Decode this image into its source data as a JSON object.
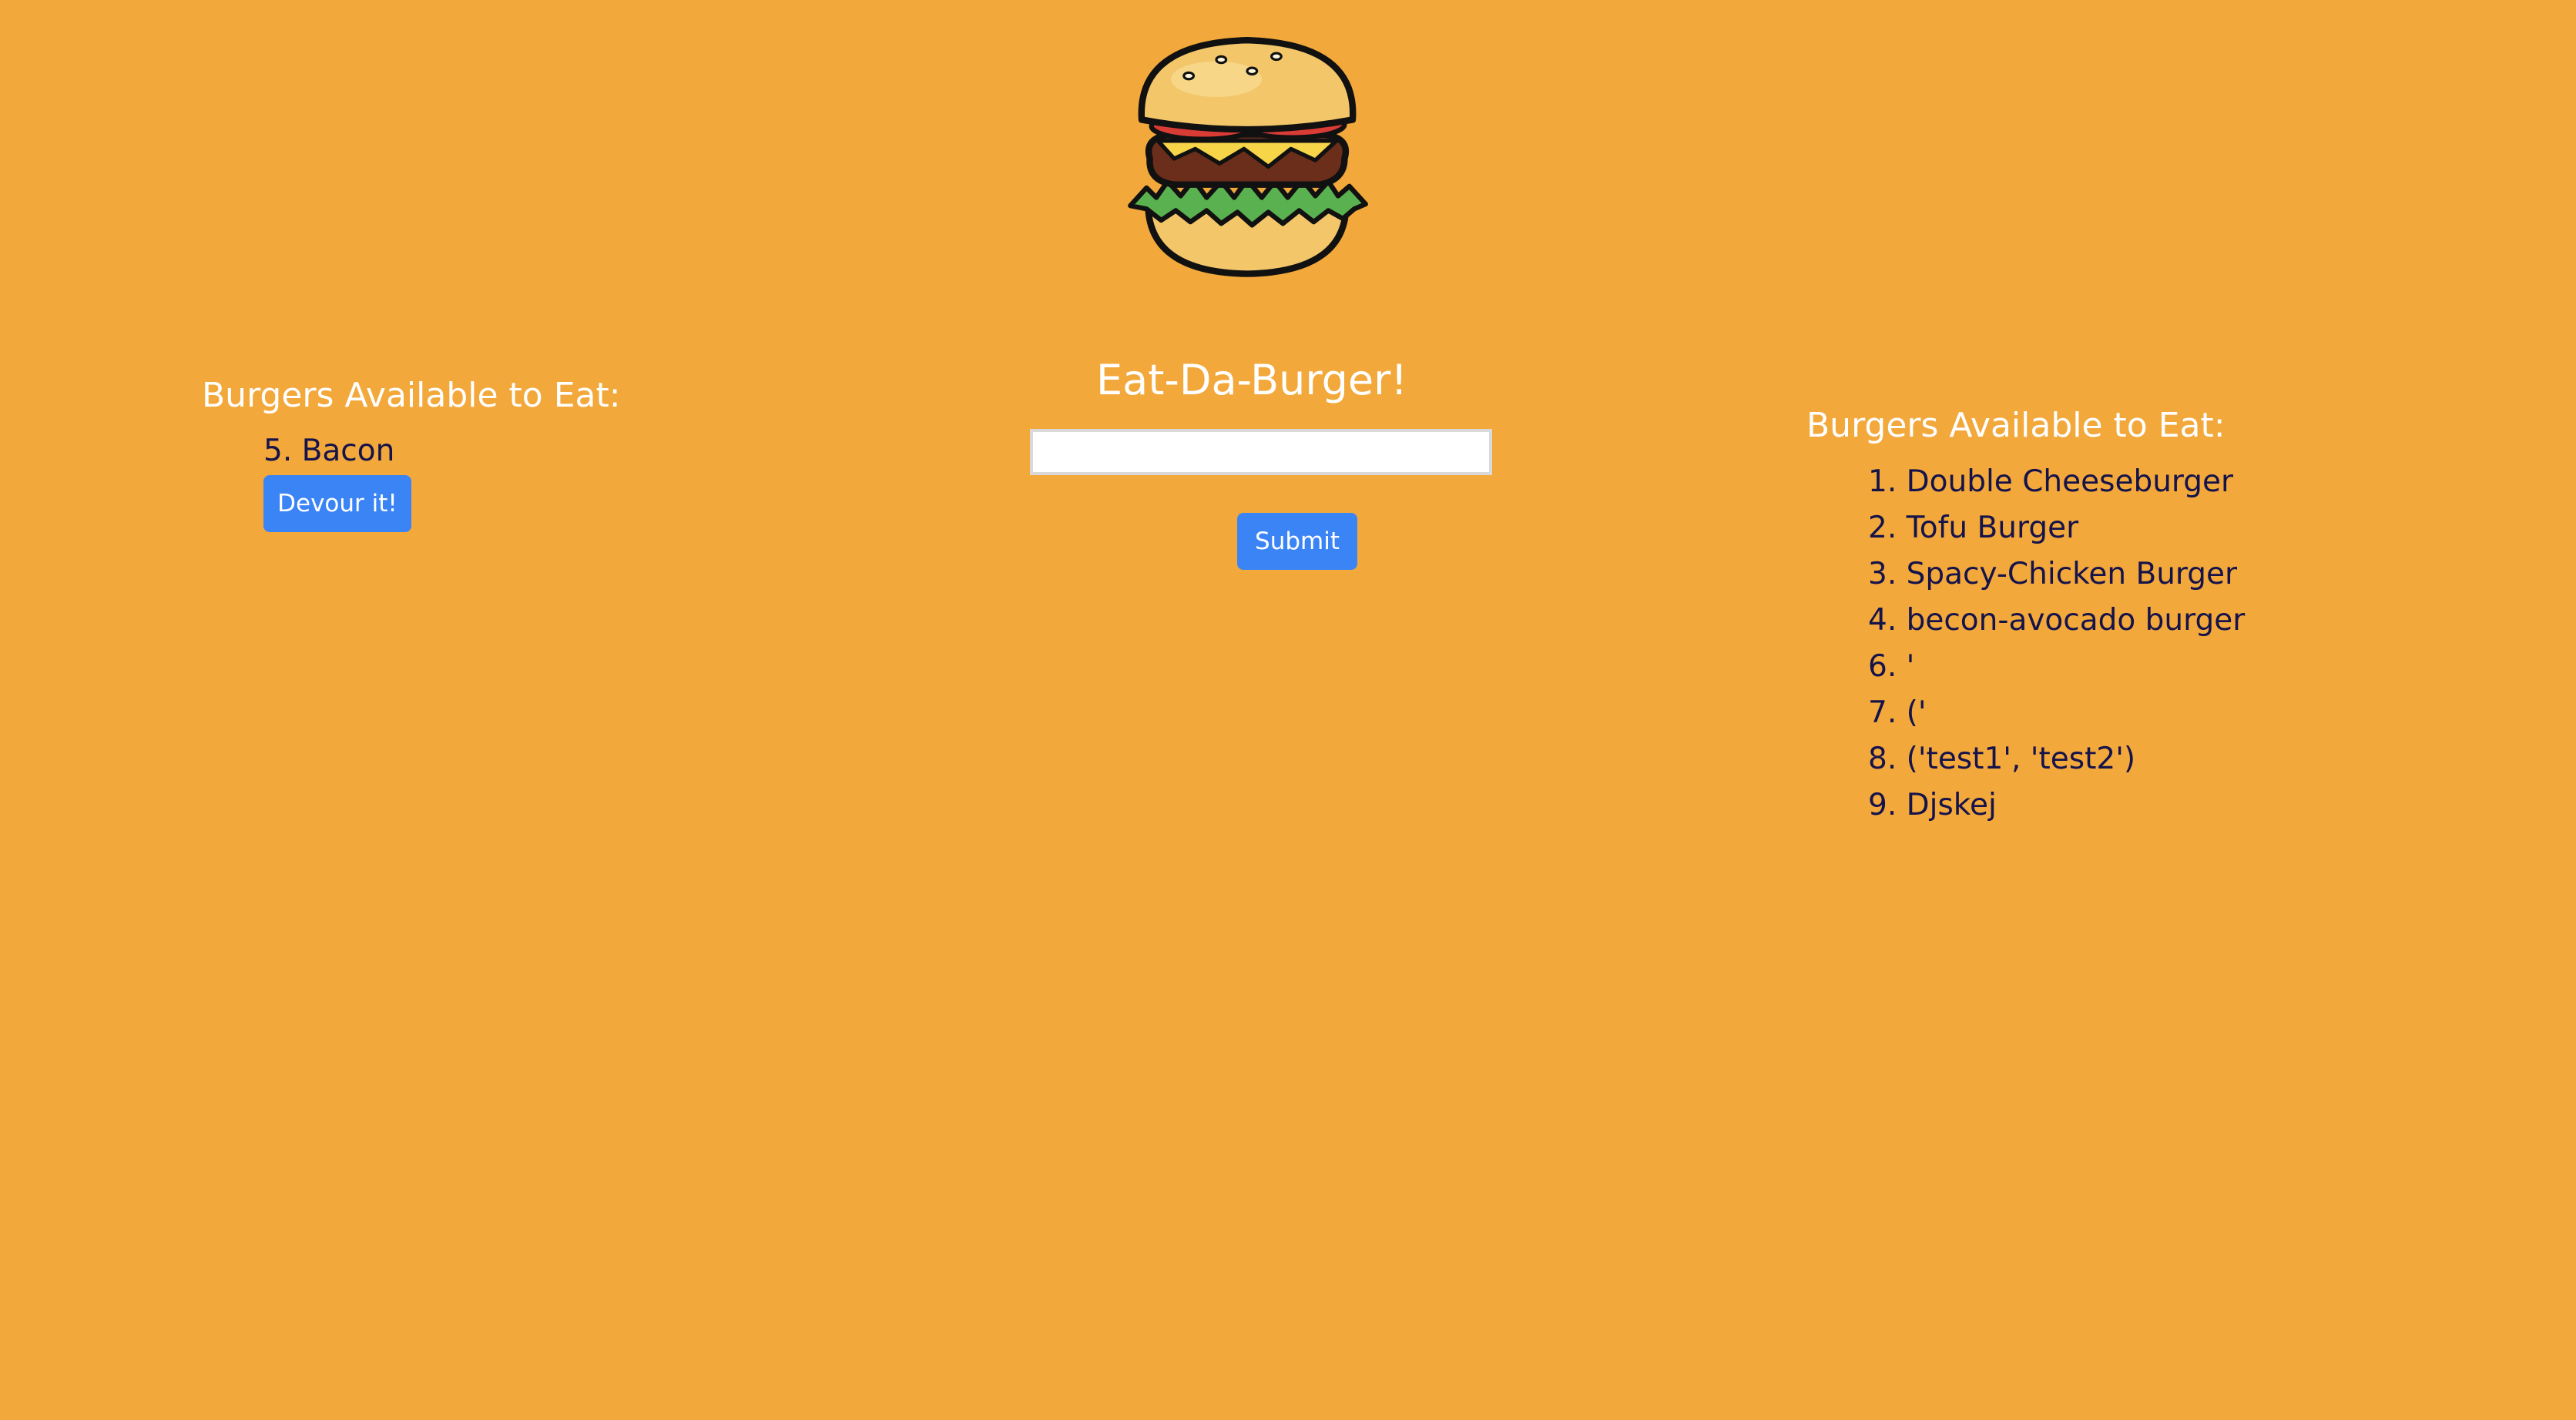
{
  "header": {
    "logo_icon": "burger-icon",
    "title": "Eat-Da-Burger!"
  },
  "form": {
    "input_value": "",
    "input_placeholder": "",
    "submit_label": "Submit"
  },
  "available": {
    "heading": "Burgers Available to Eat:",
    "items": [
      {
        "text": "5. Bacon",
        "button_label": "Devour it!"
      }
    ]
  },
  "devoured": {
    "heading": "Burgers Available to Eat:",
    "items": [
      "1. Double Cheeseburger",
      "2. Tofu Burger",
      "3. Spacy-Chicken Burger",
      "4. becon-avocado burger",
      "6. '",
      "7. ('",
      "8. ('test1', 'test2')",
      "9. Djskej"
    ]
  },
  "colors": {
    "background": "#f2a83b",
    "button": "#3a84f5",
    "heading_text": "#ffffff",
    "item_text": "#15134a"
  }
}
